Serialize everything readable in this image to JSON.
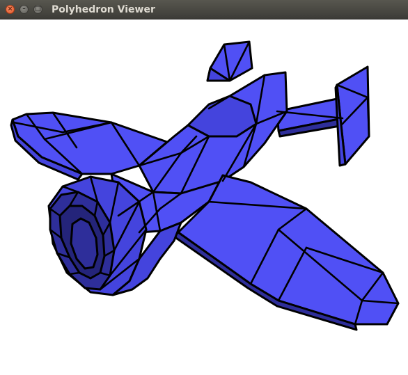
{
  "window": {
    "title": "Polyhedron Viewer",
    "close_glyph": "×",
    "minimize_glyph": "–",
    "maximize_glyph": "□"
  },
  "viewport": {
    "model": "airplane",
    "colors": {
      "face_light": "#5050f5",
      "face_mid": "#4444dd",
      "face_dark": "#2e2e9a",
      "face_darker": "#24247a",
      "edge": "#000000",
      "background": "#ffffff"
    }
  },
  "icons": {
    "close": "close-icon",
    "minimize": "minimize-icon",
    "maximize": "maximize-icon"
  }
}
